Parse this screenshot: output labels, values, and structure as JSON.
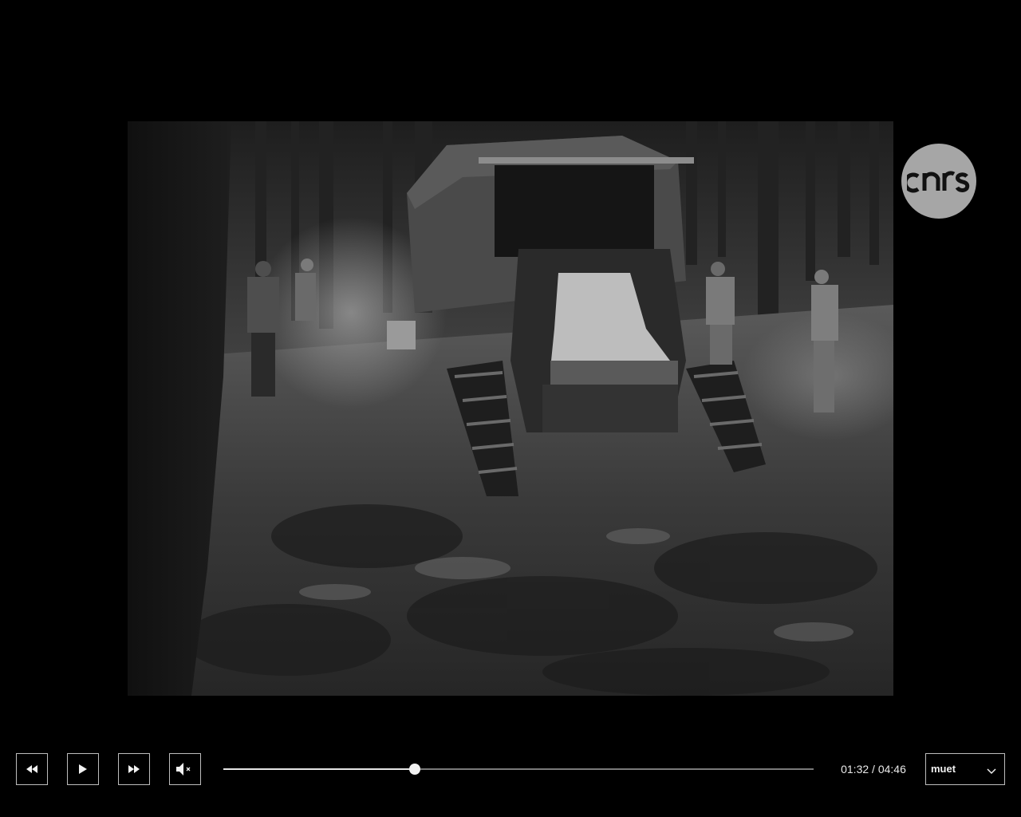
{
  "video": {
    "description_icon": "film-frame",
    "logo_text": "cnrs"
  },
  "controls": {
    "rewind_icon": "rewind-icon",
    "play_icon": "play-icon",
    "forward_icon": "fast-forward-icon",
    "mute_icon": "volume-muted-icon",
    "current_time": "01:32",
    "separator": " / ",
    "duration": "04:46",
    "progress_fraction": 0.324,
    "audio_select": {
      "selected": "muet"
    }
  },
  "colors": {
    "background": "#000000",
    "control_border": "#bdbdbd",
    "progress_track": "#7a7a7a",
    "progress_fill": "#e6e6e6",
    "logo_bg": "#a6a6a6"
  }
}
